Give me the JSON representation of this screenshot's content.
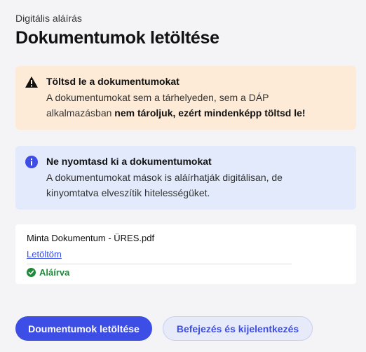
{
  "header": {
    "eyebrow": "Digitális aláírás",
    "title": "Dokumentumok letöltése"
  },
  "warning": {
    "icon": "warning-icon",
    "title": "Töltsd le a dokumentumokat",
    "body_line1": "A dokumentumokat sem a tárhelyeden, sem a DÁP",
    "body_line2_prefix": "alkalmazásban ",
    "body_line2_bold": "nem tároljuk, ezért mindenképp töltsd le!"
  },
  "info": {
    "icon": "info-icon",
    "title": "Ne nyomtasd ki a dokumentumokat",
    "body_line1": "A dokumentumokat mások is aláírhatják digitálisan, de",
    "body_line2": "kinyomtatva elveszítik hitelességüket."
  },
  "document": {
    "name": "Minta Dokumentum - ÜRES.pdf",
    "download_link": "Letöltöm",
    "status_icon": "check-circle-icon",
    "status": "Aláírva"
  },
  "actions": {
    "primary_label": "Doumentumok letöltése",
    "secondary_label": "Befejezés és kijelentkezés"
  },
  "colors": {
    "accent": "#3d4ee6",
    "warning_bg": "#fdebd8",
    "info_bg": "#e2eafb",
    "success": "#1f8a3a"
  }
}
